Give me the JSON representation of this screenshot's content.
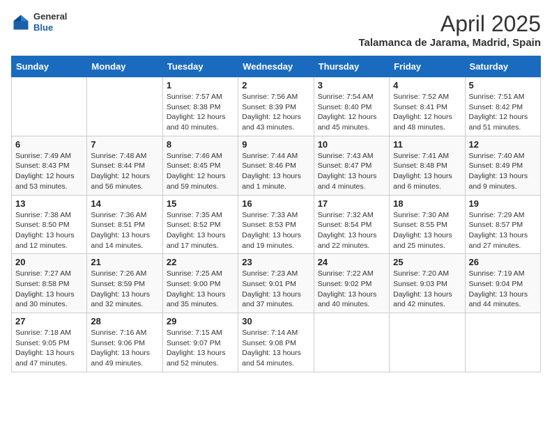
{
  "header": {
    "logo_general": "General",
    "logo_blue": "Blue",
    "month": "April 2025",
    "location": "Talamanca de Jarama, Madrid, Spain"
  },
  "days_of_week": [
    "Sunday",
    "Monday",
    "Tuesday",
    "Wednesday",
    "Thursday",
    "Friday",
    "Saturday"
  ],
  "weeks": [
    [
      {
        "day": "",
        "info": ""
      },
      {
        "day": "",
        "info": ""
      },
      {
        "day": "1",
        "info": "Sunrise: 7:57 AM\nSunset: 8:38 PM\nDaylight: 12 hours and 40 minutes."
      },
      {
        "day": "2",
        "info": "Sunrise: 7:56 AM\nSunset: 8:39 PM\nDaylight: 12 hours and 43 minutes."
      },
      {
        "day": "3",
        "info": "Sunrise: 7:54 AM\nSunset: 8:40 PM\nDaylight: 12 hours and 45 minutes."
      },
      {
        "day": "4",
        "info": "Sunrise: 7:52 AM\nSunset: 8:41 PM\nDaylight: 12 hours and 48 minutes."
      },
      {
        "day": "5",
        "info": "Sunrise: 7:51 AM\nSunset: 8:42 PM\nDaylight: 12 hours and 51 minutes."
      }
    ],
    [
      {
        "day": "6",
        "info": "Sunrise: 7:49 AM\nSunset: 8:43 PM\nDaylight: 12 hours and 53 minutes."
      },
      {
        "day": "7",
        "info": "Sunrise: 7:48 AM\nSunset: 8:44 PM\nDaylight: 12 hours and 56 minutes."
      },
      {
        "day": "8",
        "info": "Sunrise: 7:46 AM\nSunset: 8:45 PM\nDaylight: 12 hours and 59 minutes."
      },
      {
        "day": "9",
        "info": "Sunrise: 7:44 AM\nSunset: 8:46 PM\nDaylight: 13 hours and 1 minute."
      },
      {
        "day": "10",
        "info": "Sunrise: 7:43 AM\nSunset: 8:47 PM\nDaylight: 13 hours and 4 minutes."
      },
      {
        "day": "11",
        "info": "Sunrise: 7:41 AM\nSunset: 8:48 PM\nDaylight: 13 hours and 6 minutes."
      },
      {
        "day": "12",
        "info": "Sunrise: 7:40 AM\nSunset: 8:49 PM\nDaylight: 13 hours and 9 minutes."
      }
    ],
    [
      {
        "day": "13",
        "info": "Sunrise: 7:38 AM\nSunset: 8:50 PM\nDaylight: 13 hours and 12 minutes."
      },
      {
        "day": "14",
        "info": "Sunrise: 7:36 AM\nSunset: 8:51 PM\nDaylight: 13 hours and 14 minutes."
      },
      {
        "day": "15",
        "info": "Sunrise: 7:35 AM\nSunset: 8:52 PM\nDaylight: 13 hours and 17 minutes."
      },
      {
        "day": "16",
        "info": "Sunrise: 7:33 AM\nSunset: 8:53 PM\nDaylight: 13 hours and 19 minutes."
      },
      {
        "day": "17",
        "info": "Sunrise: 7:32 AM\nSunset: 8:54 PM\nDaylight: 13 hours and 22 minutes."
      },
      {
        "day": "18",
        "info": "Sunrise: 7:30 AM\nSunset: 8:55 PM\nDaylight: 13 hours and 25 minutes."
      },
      {
        "day": "19",
        "info": "Sunrise: 7:29 AM\nSunset: 8:57 PM\nDaylight: 13 hours and 27 minutes."
      }
    ],
    [
      {
        "day": "20",
        "info": "Sunrise: 7:27 AM\nSunset: 8:58 PM\nDaylight: 13 hours and 30 minutes."
      },
      {
        "day": "21",
        "info": "Sunrise: 7:26 AM\nSunset: 8:59 PM\nDaylight: 13 hours and 32 minutes."
      },
      {
        "day": "22",
        "info": "Sunrise: 7:25 AM\nSunset: 9:00 PM\nDaylight: 13 hours and 35 minutes."
      },
      {
        "day": "23",
        "info": "Sunrise: 7:23 AM\nSunset: 9:01 PM\nDaylight: 13 hours and 37 minutes."
      },
      {
        "day": "24",
        "info": "Sunrise: 7:22 AM\nSunset: 9:02 PM\nDaylight: 13 hours and 40 minutes."
      },
      {
        "day": "25",
        "info": "Sunrise: 7:20 AM\nSunset: 9:03 PM\nDaylight: 13 hours and 42 minutes."
      },
      {
        "day": "26",
        "info": "Sunrise: 7:19 AM\nSunset: 9:04 PM\nDaylight: 13 hours and 44 minutes."
      }
    ],
    [
      {
        "day": "27",
        "info": "Sunrise: 7:18 AM\nSunset: 9:05 PM\nDaylight: 13 hours and 47 minutes."
      },
      {
        "day": "28",
        "info": "Sunrise: 7:16 AM\nSunset: 9:06 PM\nDaylight: 13 hours and 49 minutes."
      },
      {
        "day": "29",
        "info": "Sunrise: 7:15 AM\nSunset: 9:07 PM\nDaylight: 13 hours and 52 minutes."
      },
      {
        "day": "30",
        "info": "Sunrise: 7:14 AM\nSunset: 9:08 PM\nDaylight: 13 hours and 54 minutes."
      },
      {
        "day": "",
        "info": ""
      },
      {
        "day": "",
        "info": ""
      },
      {
        "day": "",
        "info": ""
      }
    ]
  ]
}
